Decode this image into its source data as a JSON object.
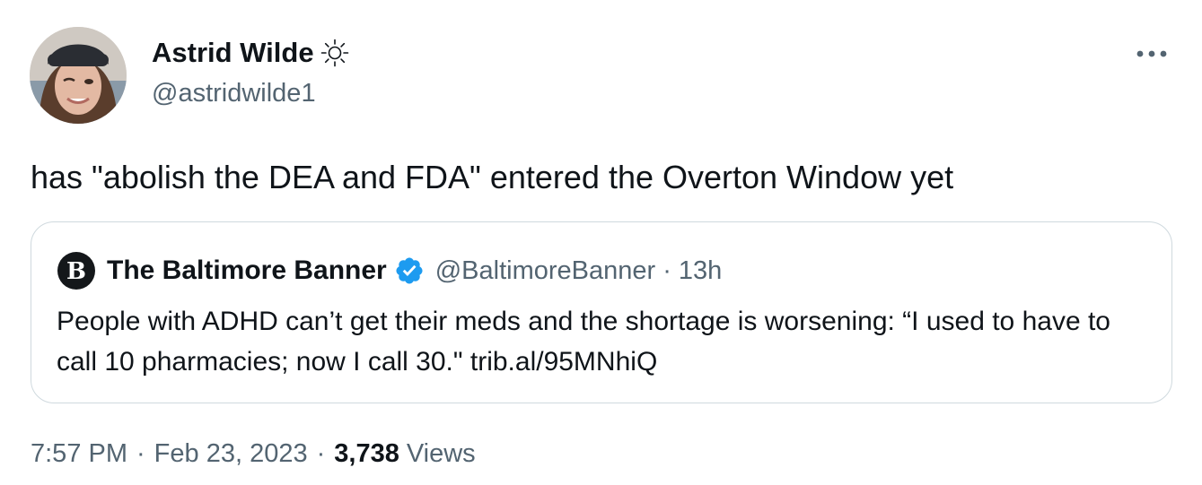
{
  "tweet": {
    "author": {
      "name": "Astrid Wilde",
      "handle": "@astridwilde1",
      "avatar_icon": "user-avatar-photo",
      "name_emoji_icon": "sun-icon"
    },
    "more_icon": "more-options-icon",
    "text": "has \"abolish the DEA and FDA\" entered the Overton Window yet",
    "quoted": {
      "logo_icon": "baltimore-banner-logo-icon",
      "name": "The Baltimore Banner",
      "verified_icon": "verified-badge-icon",
      "verified_color": "#1d9bf0",
      "handle": "@BaltimoreBanner",
      "separator": "·",
      "time": "13h",
      "body": "People with ADHD can’t get their meds and the shortage is worsening: “I used to have to call 10 pharmacies; now I call 30.\" trib.al/95MNhiQ"
    },
    "meta": {
      "time": "7:57 PM",
      "separator": "·",
      "date": "Feb 23, 2023",
      "views_count": "3,738",
      "views_label": "Views"
    }
  },
  "colors": {
    "text_primary": "#0f1419",
    "text_secondary": "#536471",
    "border": "#cfd9de",
    "accent": "#1d9bf0"
  }
}
